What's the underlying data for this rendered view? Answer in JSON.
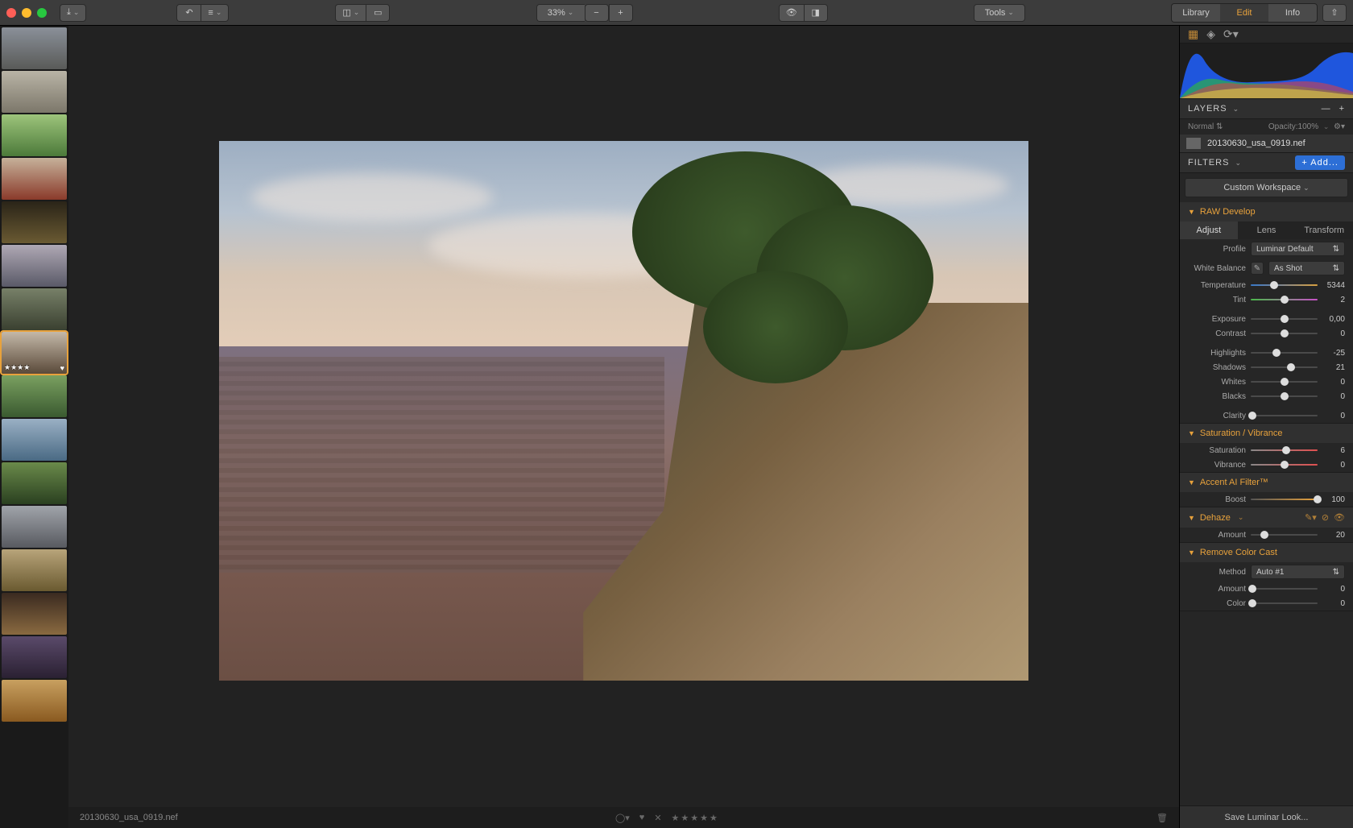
{
  "toolbar": {
    "zoom": "33%",
    "tools_label": "Tools",
    "tabs": {
      "library": "Library",
      "edit": "Edit",
      "info": "Info"
    }
  },
  "filmstrip": {
    "selected_index": 7,
    "selected_stars": "★★★★",
    "count": 16
  },
  "statusbar": {
    "filename": "20130630_usa_0919.nef",
    "stars": "★★★★★"
  },
  "panel": {
    "layers": {
      "title": "LAYERS",
      "blend_mode": "Normal",
      "opacity_label": "Opacity:",
      "opacity": "100%",
      "layer_name": "20130630_usa_0919.nef"
    },
    "filters": {
      "title": "FILTERS",
      "add_label": "+ Add...",
      "workspace": "Custom Workspace"
    },
    "raw": {
      "title": "RAW Develop",
      "subtabs": {
        "adjust": "Adjust",
        "lens": "Lens",
        "transform": "Transform"
      },
      "profile_label": "Profile",
      "profile_value": "Luminar Default",
      "wb_label": "White Balance",
      "wb_value": "As Shot",
      "sliders": {
        "temperature": {
          "label": "Temperature",
          "value": "5344",
          "pos": 35
        },
        "tint": {
          "label": "Tint",
          "value": "2",
          "pos": 50
        },
        "exposure": {
          "label": "Exposure",
          "value": "0,00",
          "pos": 50
        },
        "contrast": {
          "label": "Contrast",
          "value": "0",
          "pos": 50
        },
        "highlights": {
          "label": "Highlights",
          "value": "-25",
          "pos": 38
        },
        "shadows": {
          "label": "Shadows",
          "value": "21",
          "pos": 60
        },
        "whites": {
          "label": "Whites",
          "value": "0",
          "pos": 50
        },
        "blacks": {
          "label": "Blacks",
          "value": "0",
          "pos": 50
        },
        "clarity": {
          "label": "Clarity",
          "value": "0",
          "pos": 2
        }
      }
    },
    "satvib": {
      "title": "Saturation / Vibrance",
      "saturation": {
        "label": "Saturation",
        "value": "6",
        "pos": 53
      },
      "vibrance": {
        "label": "Vibrance",
        "value": "0",
        "pos": 50
      }
    },
    "accent": {
      "title": "Accent AI Filter™",
      "boost": {
        "label": "Boost",
        "value": "100",
        "pos": 100
      }
    },
    "dehaze": {
      "title": "Dehaze",
      "amount": {
        "label": "Amount",
        "value": "20",
        "pos": 20
      }
    },
    "rcc": {
      "title": "Remove Color Cast",
      "method_label": "Method",
      "method_value": "Auto #1",
      "amount": {
        "label": "Amount",
        "value": "0",
        "pos": 2
      },
      "color": {
        "label": "Color",
        "value": "0",
        "pos": 2
      }
    },
    "save_look": "Save Luminar Look..."
  }
}
